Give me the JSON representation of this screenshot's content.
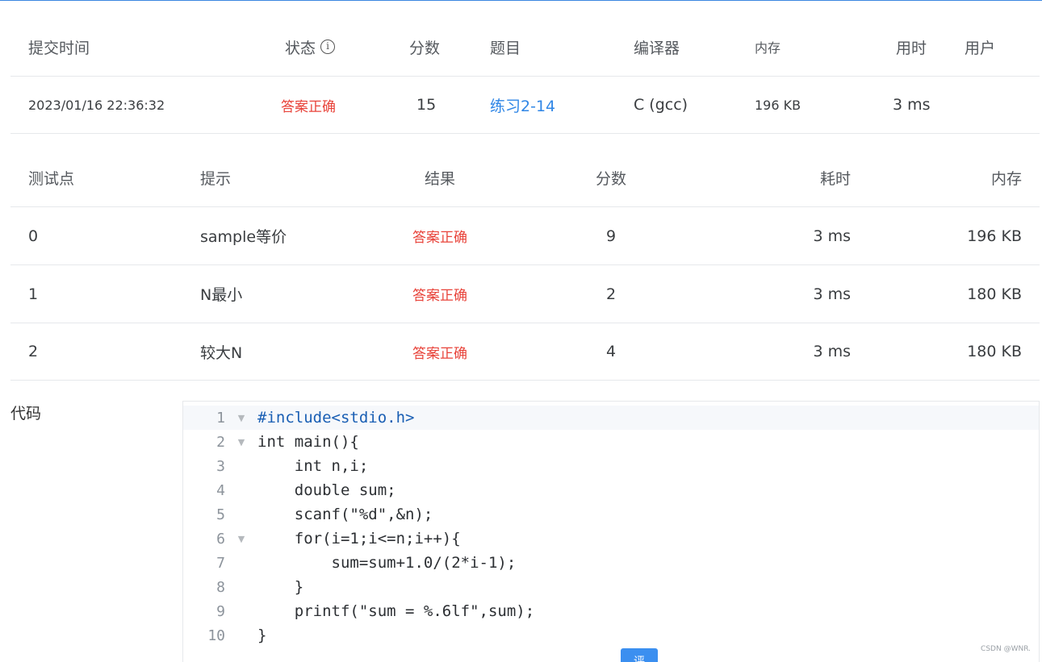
{
  "submission": {
    "headers": {
      "time": "提交时间",
      "status": "状态",
      "score": "分数",
      "problem": "题目",
      "compiler": "编译器",
      "memory": "内存",
      "duration": "用时",
      "user": "用户"
    },
    "row": {
      "time": "2023/01/16 22:36:32",
      "status": "答案正确",
      "score": "15",
      "problem": "练习2-14",
      "compiler": "C (gcc)",
      "memory": "196 KB",
      "duration": "3 ms",
      "user": ""
    },
    "status_info_icon": "info-circle-icon"
  },
  "testcases": {
    "headers": {
      "id": "测试点",
      "hint": "提示",
      "result": "结果",
      "score": "分数",
      "time": "耗时",
      "memory": "内存"
    },
    "rows": [
      {
        "id": "0",
        "hint": "sample等价",
        "result": "答案正确",
        "score": "9",
        "time": "3 ms",
        "memory": "196 KB"
      },
      {
        "id": "1",
        "hint": "N最小",
        "result": "答案正确",
        "score": "2",
        "time": "3 ms",
        "memory": "180 KB"
      },
      {
        "id": "2",
        "hint": "较大N",
        "result": "答案正确",
        "score": "4",
        "time": "3 ms",
        "memory": "180 KB"
      }
    ]
  },
  "code": {
    "label": "代码",
    "line_numbers": [
      "1",
      "2",
      "3",
      "4",
      "5",
      "6",
      "7",
      "8",
      "9",
      "10"
    ],
    "lines": [
      "#include<stdio.h>",
      "int main(){",
      "    int n,i;",
      "    double sum;",
      "    scanf(\"%d\",&n);",
      "    for(i=1;i<=n;i++){",
      "        sum=sum+1.0/(2*i-1);",
      "    }",
      "    printf(\"sum = %.6lf\",sum);",
      "}"
    ]
  },
  "bottom_button_label": "评",
  "watermark": "CSDN @WNR.",
  "colors": {
    "accent": "#2f86e6",
    "accepted": "#e8433a",
    "border": "#e6e8eb"
  }
}
